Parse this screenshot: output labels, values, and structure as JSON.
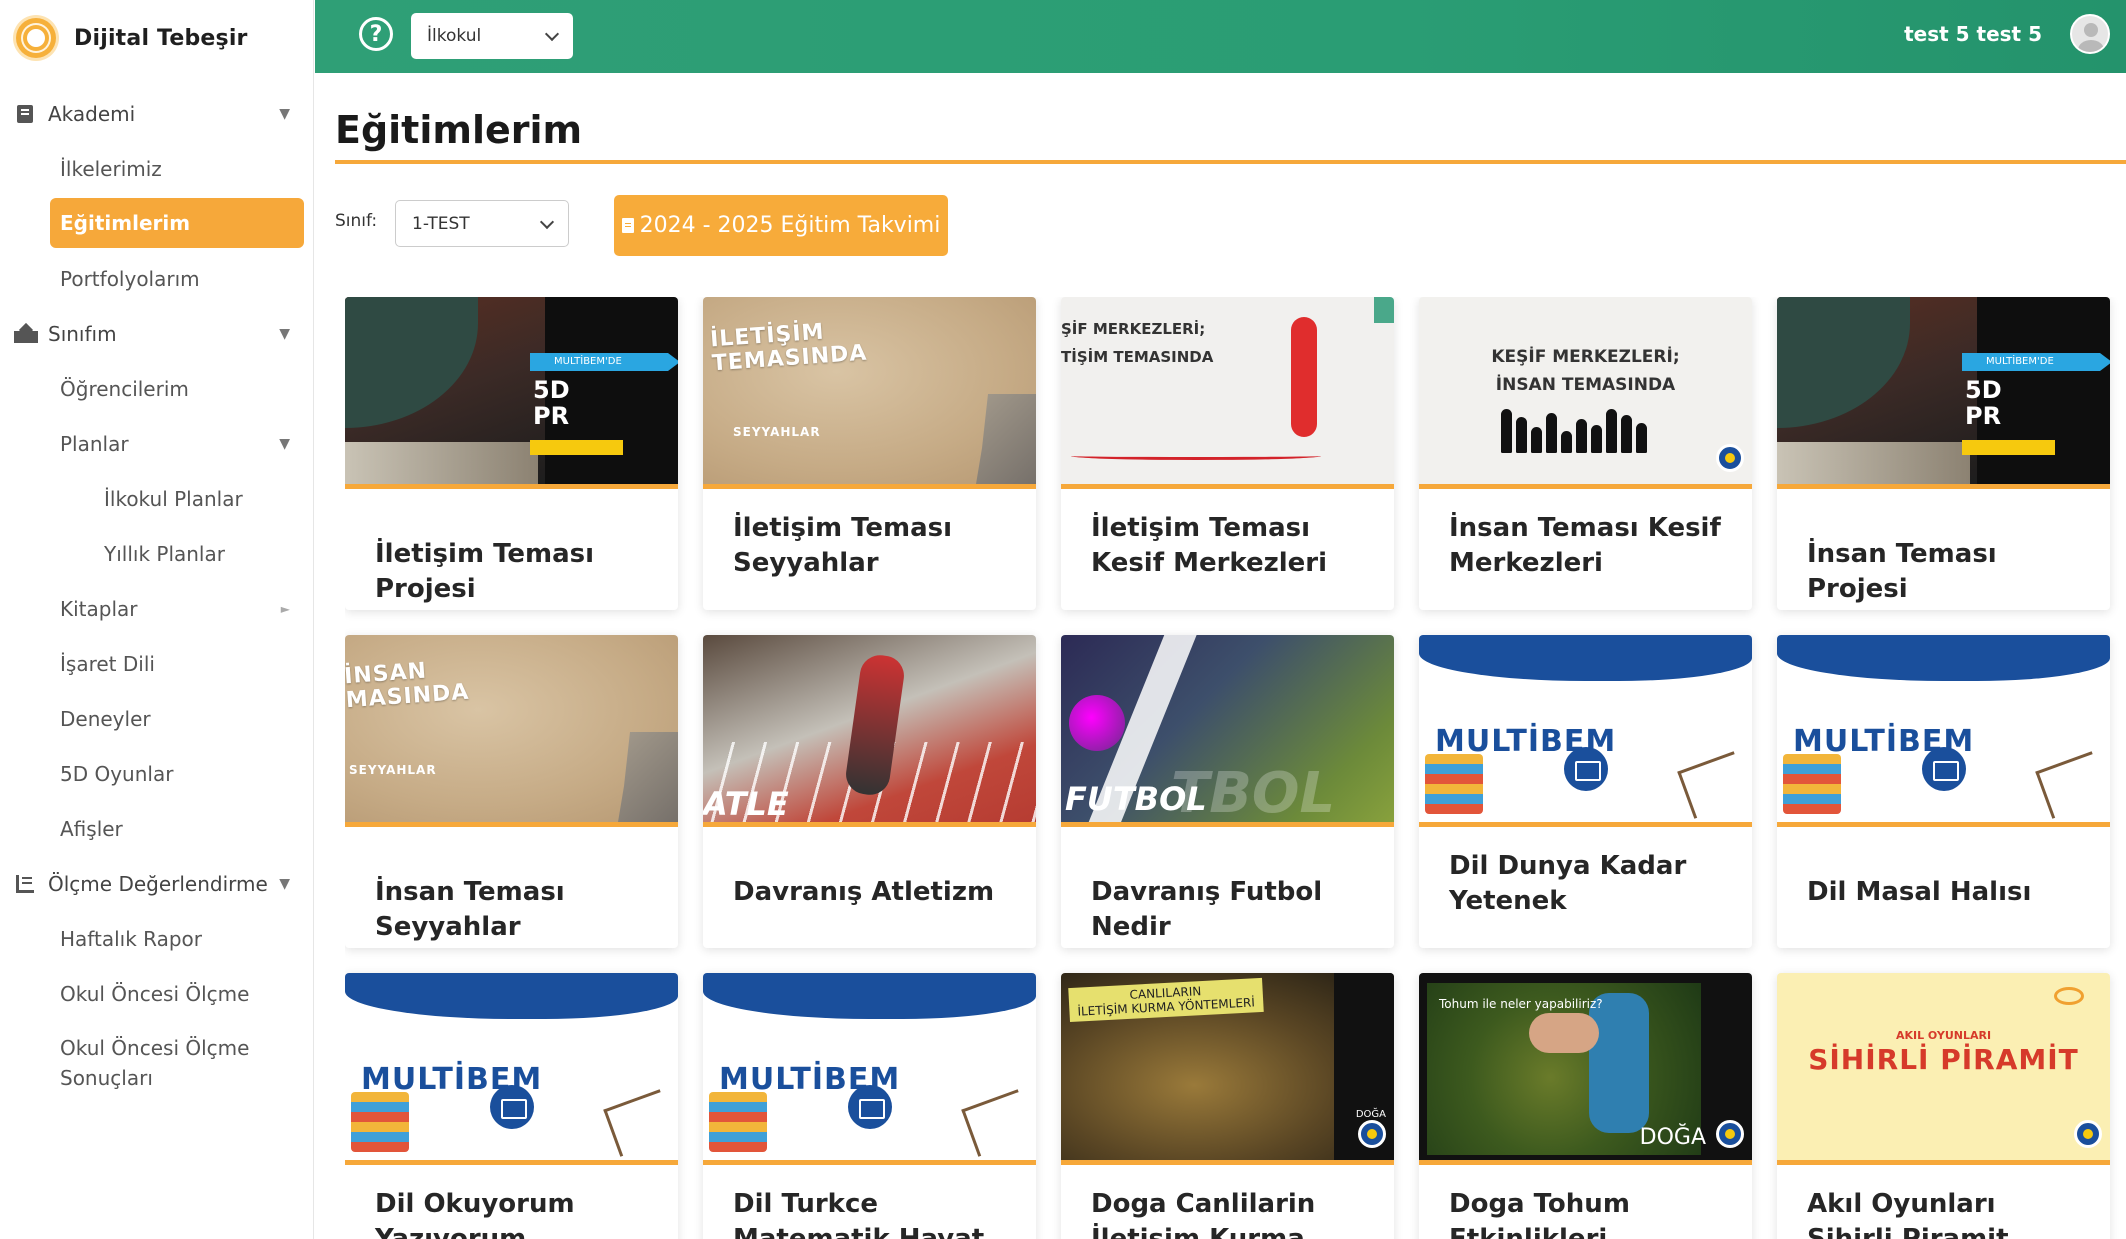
{
  "brand": {
    "name": "Dijital Tebeşir"
  },
  "sidebar": {
    "items": [
      {
        "label": "Akademi"
      },
      {
        "label": "İlkelerimiz"
      },
      {
        "label": "Eğitimlerim"
      },
      {
        "label": "Portfolyolarım"
      },
      {
        "label": "Sınıfım"
      },
      {
        "label": "Öğrencilerim"
      },
      {
        "label": "Planlar"
      },
      {
        "label": "İlkokul Planlar"
      },
      {
        "label": "Yıllık Planlar"
      },
      {
        "label": "Kitaplar"
      },
      {
        "label": "İşaret Dili"
      },
      {
        "label": "Deneyler"
      },
      {
        "label": "5D Oyunlar"
      },
      {
        "label": "Afişler"
      },
      {
        "label": "Ölçme Değerlendirme"
      },
      {
        "label": "Haftalık Rapor"
      },
      {
        "label": "Okul Öncesi Ölçme"
      },
      {
        "label": "Okul Öncesi Ölçme Sonuçları"
      }
    ]
  },
  "header": {
    "school_select": "İlkokul",
    "user_name": "test 5 test 5",
    "help_symbol": "?"
  },
  "main": {
    "title": "Eğitimlerim",
    "filter_label": "Sınıf:",
    "class_select": "1-TEST",
    "calendar_button": "2024 - 2025 Eğitim Takvimi"
  },
  "thumbs": {
    "multibem_tag": "MULTİBEM'DE",
    "five_d": "5D",
    "pr": "PR",
    "iletisim_head": "İLETİŞİM\nTEMASINDA",
    "insan_head": "İNSAN\nMASINDA",
    "seyyahlar": "SEYYAHLAR",
    "kesif_phone": "ŞİF MERKEZLERİ;\nTİŞİM TEMASINDA",
    "kesif_family": "KEŞİF MERKEZLERİ;\nİNSAN TEMASINDA",
    "atle": "ATLE",
    "futbol": "FUTBOL",
    "futbol_ghost": "TBOL",
    "multibem": "MULTİBEM",
    "canlilar": "CANLILARIN\nİLETİŞİM KURMA YÖNTEMLERİ",
    "doga": "DOĞA",
    "tohum_q": "Tohum ile neler yapabiliriz?",
    "akil": "AKIL OYUNLARI",
    "sihirli": "SİHİRLİ PİRAMİT"
  },
  "cards": [
    {
      "title": "İletişim Teması Projesi"
    },
    {
      "title": "İletişim Teması Seyyahlar"
    },
    {
      "title": "İletişim Teması Kesif Merkezleri"
    },
    {
      "title": "İnsan Teması Kesif Merkezleri"
    },
    {
      "title": "İnsan Teması Projesi"
    },
    {
      "title": "İnsan Teması Seyyahlar"
    },
    {
      "title": "Davranış Atletizm"
    },
    {
      "title": "Davranış Futbol Nedir"
    },
    {
      "title": "Dil Dunya Kadar Yetenek"
    },
    {
      "title": "Dil Masal Halısı"
    },
    {
      "title": "Dil Okuyorum Yazıyorum"
    },
    {
      "title": "Dil Turkce Matematik Hayat Bilgisi"
    },
    {
      "title": "Doga Canlilarin İletişim Kurma Yontemleri"
    },
    {
      "title": "Doga Tohum Etkinlikleri"
    },
    {
      "title": "Akıl Oyunları Sihirli Piramit"
    }
  ],
  "colors": {
    "accent": "#f6a83a",
    "header": "#2a9d74",
    "multibem_blue": "#1a4f9c"
  }
}
